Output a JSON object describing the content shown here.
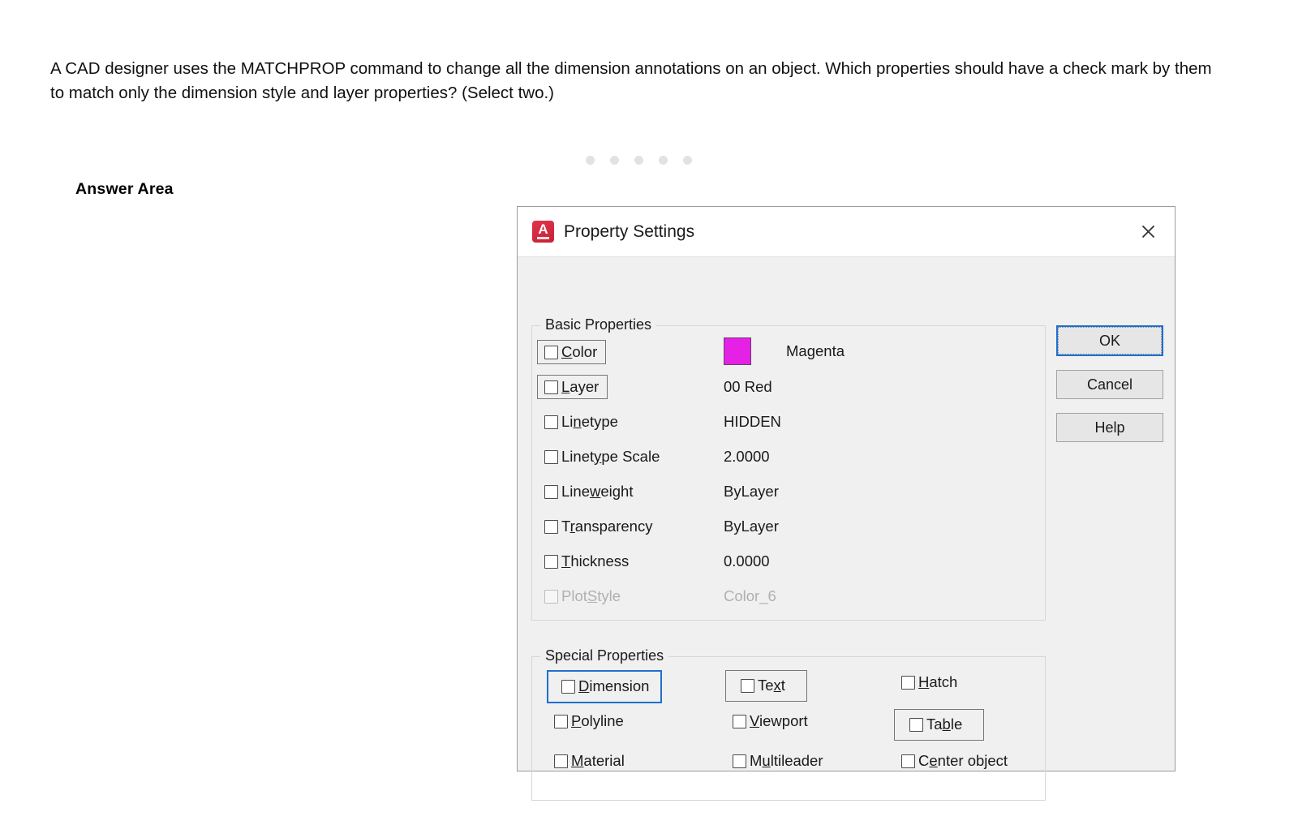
{
  "question": {
    "text": "A CAD designer uses the MATCHPROP command to change all the dimension annotations on an object. Which properties should have a check mark by them to match only the dimension style and layer properties? (Select two.)"
  },
  "answer_area": {
    "label": "Answer Area"
  },
  "loader": {
    "dot_count": 5,
    "dot_color": "#e2e2e2"
  },
  "dialog": {
    "title": "Property Settings",
    "app_icon": "autocad-a-icon",
    "close_icon": "close-icon",
    "basic_properties": {
      "legend": "Basic Properties",
      "rows": [
        {
          "label": "Color",
          "accel": "C",
          "checked": false,
          "selection": "gray",
          "enabled": true,
          "value": "Magenta",
          "value_type": "color",
          "swatch_color": "#e421e4"
        },
        {
          "label": "Layer",
          "accel": "L",
          "checked": false,
          "selection": "gray",
          "enabled": true,
          "value": "00 Red",
          "value_type": "text"
        },
        {
          "label": "Linetype",
          "accel": "n",
          "checked": false,
          "selection": "none",
          "enabled": true,
          "value": "HIDDEN",
          "value_type": "text"
        },
        {
          "label": "Linetype Scale",
          "accel": "y",
          "checked": false,
          "selection": "none",
          "enabled": true,
          "value": "2.0000",
          "value_type": "text"
        },
        {
          "label": "Lineweight",
          "accel": "w",
          "checked": false,
          "selection": "none",
          "enabled": true,
          "value": "ByLayer",
          "value_type": "text"
        },
        {
          "label": "Transparency",
          "accel": "r",
          "checked": false,
          "selection": "none",
          "enabled": true,
          "value": "ByLayer",
          "value_type": "text"
        },
        {
          "label": "Thickness",
          "accel": "T",
          "checked": false,
          "selection": "none",
          "enabled": true,
          "value": "0.0000",
          "value_type": "text"
        },
        {
          "label": "PlotStyle",
          "accel": "S",
          "checked": false,
          "selection": "none",
          "enabled": false,
          "value": "Color_6",
          "value_type": "text"
        }
      ]
    },
    "special_properties": {
      "legend": "Special Properties",
      "items": [
        {
          "label": "Dimension",
          "accel": "D",
          "checked": false,
          "selection": "blue",
          "col": 0,
          "row": 0
        },
        {
          "label": "Text",
          "accel": "x",
          "checked": false,
          "selection": "gray",
          "col": 1,
          "row": 0
        },
        {
          "label": "Hatch",
          "accel": "H",
          "checked": false,
          "selection": "none",
          "col": 2,
          "row": 0
        },
        {
          "label": "Polyline",
          "accel": "P",
          "checked": false,
          "selection": "none",
          "col": 0,
          "row": 1
        },
        {
          "label": "Viewport",
          "accel": "V",
          "checked": false,
          "selection": "none",
          "col": 1,
          "row": 1
        },
        {
          "label": "Table",
          "accel": "b",
          "checked": false,
          "selection": "gray",
          "col": 2,
          "row": 1
        },
        {
          "label": "Material",
          "accel": "M",
          "checked": false,
          "selection": "none",
          "col": 0,
          "row": 2
        },
        {
          "label": "Multileader",
          "accel": "u",
          "checked": false,
          "selection": "none",
          "col": 1,
          "row": 2
        },
        {
          "label": "Center object",
          "accel": "e",
          "checked": false,
          "selection": "none",
          "col": 2,
          "row": 2
        }
      ]
    },
    "buttons": [
      {
        "label": "OK",
        "default": true
      },
      {
        "label": "Cancel",
        "default": false
      },
      {
        "label": "Help",
        "default": false
      }
    ]
  },
  "colors": {
    "focus_blue": "#1d6fd0",
    "magenta": "#e421e4",
    "dialog_bg": "#f0f0f0"
  }
}
